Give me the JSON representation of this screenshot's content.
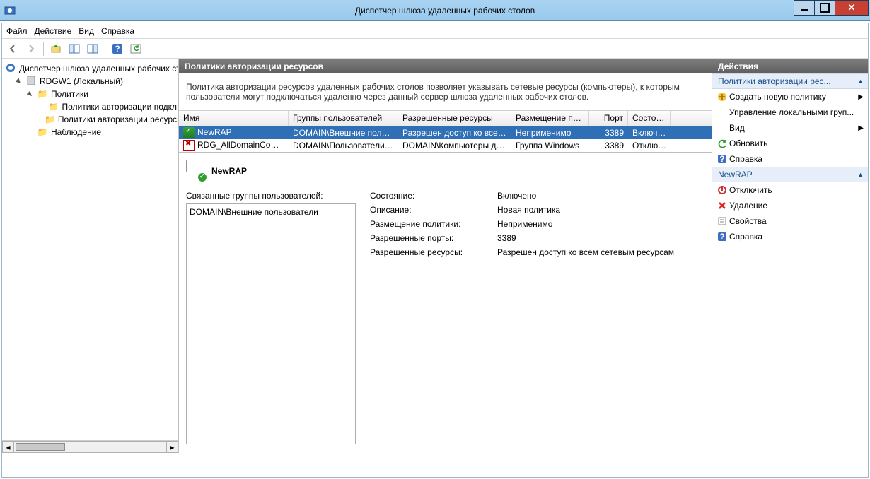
{
  "window": {
    "title": "Диспетчер шлюза удаленных рабочих столов"
  },
  "menu": {
    "file": "Файл",
    "action": "Действие",
    "view": "Вид",
    "help": "Справка"
  },
  "tree": {
    "root": "Диспетчер шлюза удаленных рабочих стол",
    "server": "RDGW1 (Локальный)",
    "policies": "Политики",
    "cap": "Политики авторизации подкл",
    "rap": "Политики авторизации ресурс",
    "monitoring": "Наблюдение"
  },
  "center": {
    "header": "Политики авторизации ресурсов",
    "description": "Политика авторизации ресурсов удаленных рабочих столов позволяет указывать сетевые ресурсы (компьютеры), к которым пользователи могут подключаться удаленно через данный сервер шлюза удаленных рабочих столов.",
    "columns": {
      "name": "Имя",
      "groups": "Группы пользователей",
      "resources": "Разрешенные ресурсы",
      "placement": "Размещение полити...",
      "port": "Порт",
      "state": "Состоя..."
    },
    "rows": [
      {
        "name": "NewRAP",
        "groups": "DOMAIN\\Внешние пользоват...",
        "resources": "Разрешен доступ ко всем с...",
        "placement": "Неприменимо",
        "port": "3389",
        "state": "Включено",
        "selected": true,
        "ok": true
      },
      {
        "name": "RDG_AllDomainComputers",
        "groups": "DOMAIN\\Пользователи домена",
        "resources": "DOMAIN\\Компьютеры домена",
        "placement": "Группа Windows",
        "port": "3389",
        "state": "Отключ...",
        "selected": false,
        "ok": false
      }
    ]
  },
  "detail": {
    "title": "NewRAP",
    "groups_label": "Связанные группы пользователей:",
    "groups_value": "DOMAIN\\Внешние пользователи",
    "state_label": "Состояние:",
    "state_value": "Включено",
    "desc_label": "Описание:",
    "desc_value": "Новая политика",
    "placement_label": "Размещение политики:",
    "placement_value": "Неприменимо",
    "ports_label": "Разрешенные порты:",
    "ports_value": "3389",
    "resources_label": "Разрешенные ресурсы:",
    "resources_value": "Разрешен доступ ко всем сетевым ресурсам"
  },
  "actions": {
    "header": "Действия",
    "group1": "Политики авторизации рес...",
    "create": "Создать новую политику",
    "manage": "Управление локальными груп...",
    "view": "Вид",
    "refresh": "Обновить",
    "help": "Справка",
    "group2": "NewRAP",
    "disable": "Отключить",
    "delete": "Удаление",
    "props": "Свойства",
    "help2": "Справка"
  }
}
